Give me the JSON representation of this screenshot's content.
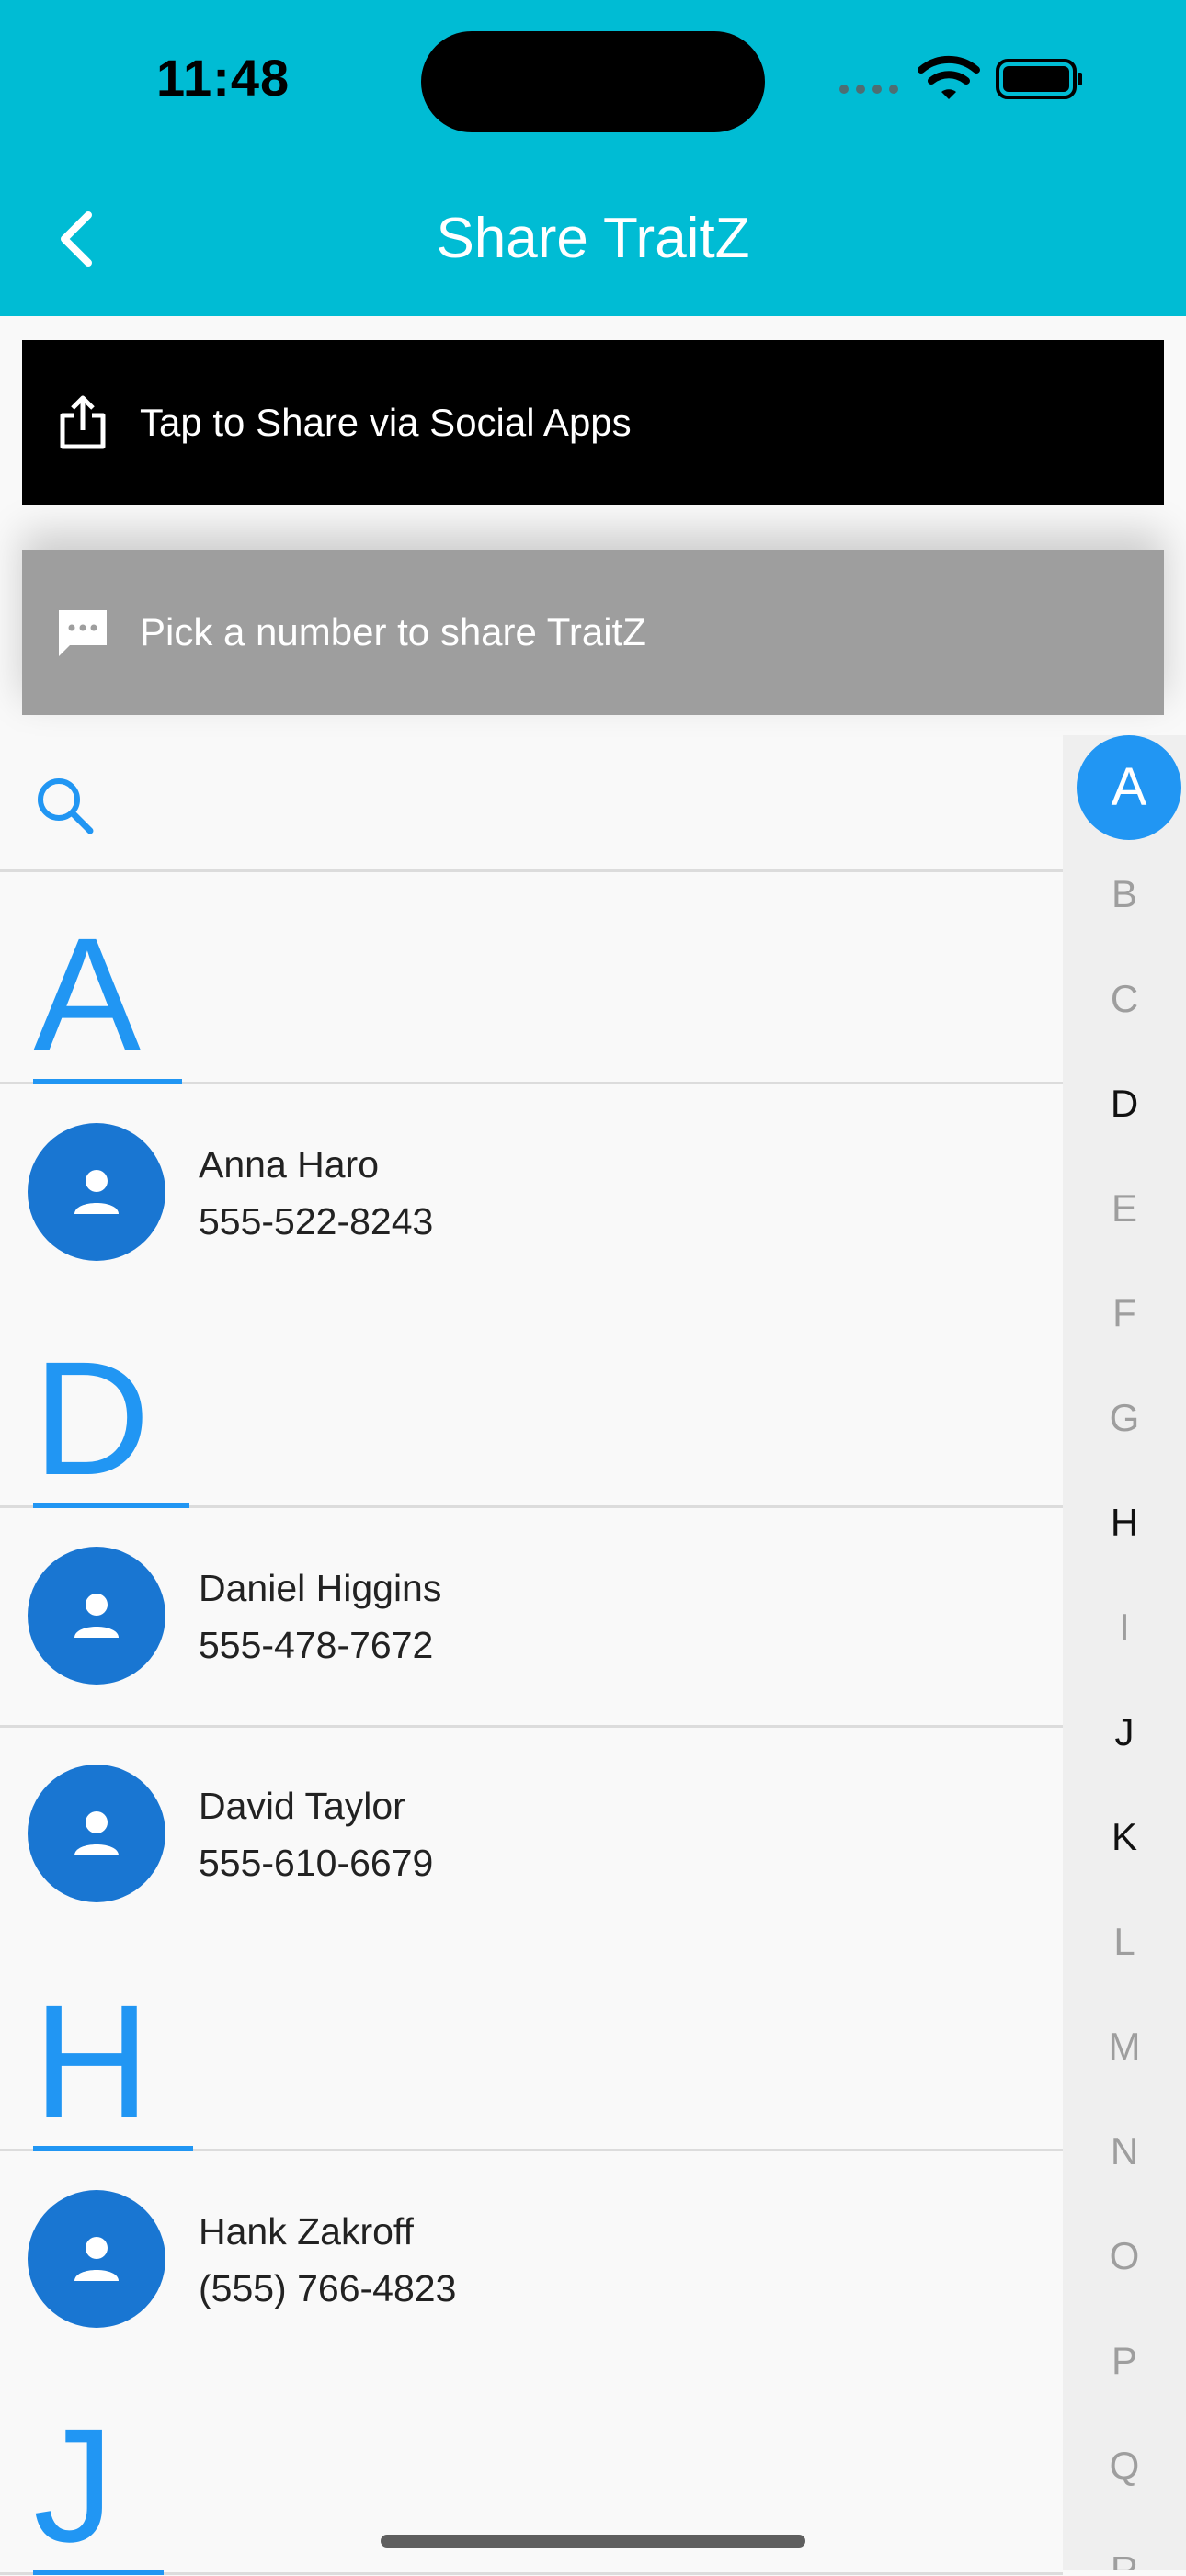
{
  "status_bar": {
    "time": "11:48"
  },
  "app_bar": {
    "title": "Share TraitZ",
    "background_color": "#00bcd4",
    "back_icon": "chevron-left-icon"
  },
  "share_banner": {
    "label": "Tap to Share via Social Apps",
    "icon": "share-icon"
  },
  "sms_banner": {
    "label": "Pick a number to share TraitZ",
    "icon": "message-icon"
  },
  "search": {
    "icon": "search-icon",
    "value": "",
    "placeholder": ""
  },
  "contacts": {
    "sections": [
      {
        "letter": "A",
        "items": [
          {
            "name": "Anna Haro",
            "phone": "555-522-8243"
          }
        ]
      },
      {
        "letter": "D",
        "items": [
          {
            "name": "Daniel Higgins",
            "phone": "555-478-7672"
          },
          {
            "name": "David Taylor",
            "phone": "555-610-6679"
          }
        ]
      },
      {
        "letter": "H",
        "items": [
          {
            "name": "Hank Zakroff",
            "phone": "(555) 766-4823"
          }
        ]
      },
      {
        "letter": "J",
        "items": []
      }
    ]
  },
  "alphabet_index": {
    "selected": "A",
    "letters": [
      "A",
      "B",
      "C",
      "D",
      "E",
      "F",
      "G",
      "H",
      "I",
      "J",
      "K",
      "L",
      "M",
      "N",
      "O",
      "P",
      "Q",
      "R"
    ],
    "letters_with_contacts": [
      "A",
      "D",
      "H",
      "J",
      "K"
    ]
  },
  "colors": {
    "accent": "#2196f3",
    "avatar": "#1976d2",
    "share_banner_bg": "#000000",
    "sms_banner_bg": "#9e9e9e"
  }
}
